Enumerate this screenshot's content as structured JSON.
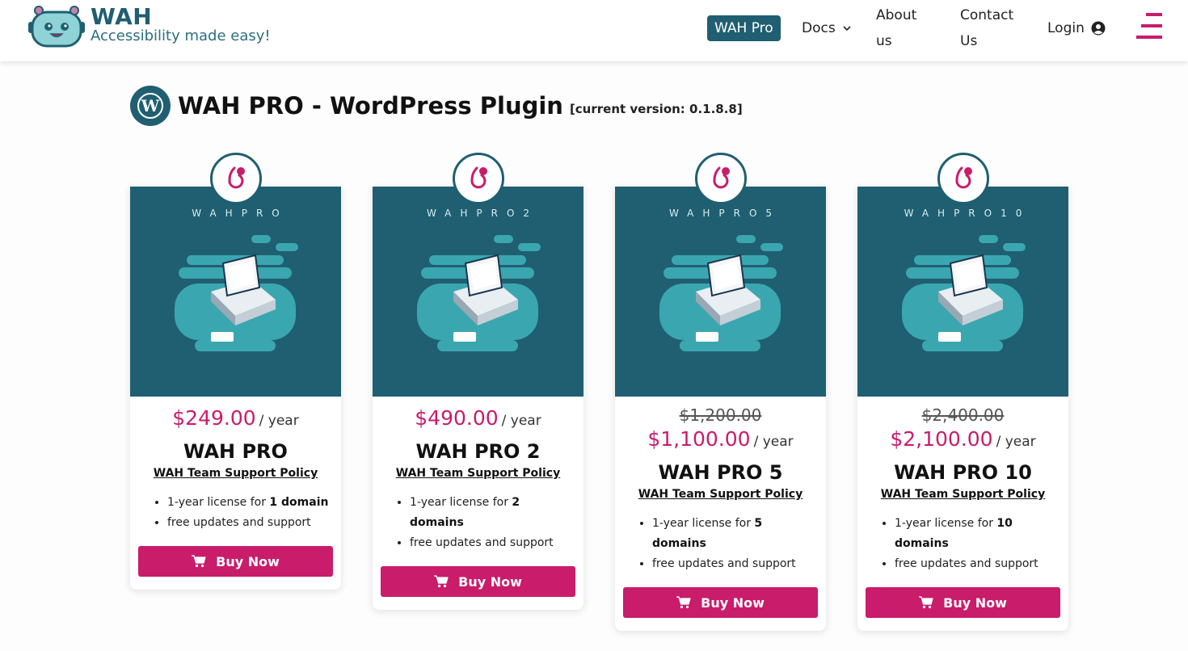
{
  "header": {
    "logo_title": "WAH",
    "logo_subtitle": "Accessibility made easy!",
    "nav": {
      "wah_pro": "WAH Pro",
      "docs": "Docs",
      "about": "About us",
      "contact": "Contact Us",
      "login": "Login"
    }
  },
  "page": {
    "title": "WAH PRO - WordPress Plugin",
    "version": "[current version: 0.1.8.8]"
  },
  "colors": {
    "brand": "#1f5f71",
    "accent": "#c91c6b"
  },
  "plans": [
    {
      "image_label": "WAHPRO",
      "old_price": "",
      "price": "$249.00",
      "period": "/ year",
      "name": "WAH PRO",
      "policy": "WAH Team Support Policy",
      "feature1_prefix": "1-year license for ",
      "feature1_bold": "1 domain",
      "feature2": "free updates and support",
      "buy": "Buy Now"
    },
    {
      "image_label": "WAHPRO2",
      "old_price": "",
      "price": "$490.00",
      "period": "/ year",
      "name": "WAH PRO 2",
      "policy": "WAH Team Support Policy",
      "feature1_prefix": "1-year license for ",
      "feature1_bold": "2 domains",
      "feature2": "free updates and support",
      "buy": "Buy Now"
    },
    {
      "image_label": "WAHPRO5",
      "old_price": "$1,200.00",
      "price": "$1,100.00",
      "period": "/ year",
      "name": "WAH PRO 5",
      "policy": "WAH Team Support Policy",
      "feature1_prefix": "1-year license for ",
      "feature1_bold": "5 domains",
      "feature2": "free updates and support",
      "buy": "Buy Now"
    },
    {
      "image_label": "WAHPRO10",
      "old_price": "$2,400.00",
      "price": "$2,100.00",
      "period": "/ year",
      "name": "WAH PRO 10",
      "policy": "WAH Team Support Policy",
      "feature1_prefix": "1-year license for ",
      "feature1_bold": "10 domains",
      "feature2": "free updates and support",
      "buy": "Buy Now"
    }
  ]
}
